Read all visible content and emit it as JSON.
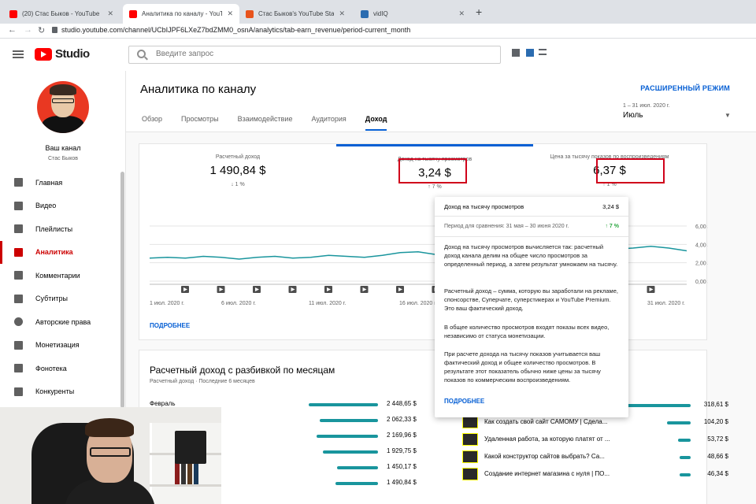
{
  "browser": {
    "tabs": [
      {
        "title": "(20) Стас Быков - YouTube",
        "icon_color": "#ff0000"
      },
      {
        "title": "Аналитика по каналу - YouTube",
        "icon_color": "#ff0000"
      },
      {
        "title": "Стас Быков's YouTube Stats (Sum",
        "icon_color": "#e8531c"
      },
      {
        "title": "vidIQ",
        "icon_color": "#2b6cb0"
      }
    ],
    "new_tab": "+",
    "url": "studio.youtube.com/channel/UCbIJPF6LXeZ7bdZMM0_osnA/analytics/tab-earn_revenue/period-current_month"
  },
  "header": {
    "logo_text": "Studio",
    "search_placeholder": "Введите запрос"
  },
  "sidebar": {
    "channel_name": "Ваш канал",
    "channel_sub": "Стас Быков",
    "items": [
      {
        "label": "Главная",
        "icon": "dashboard-icon"
      },
      {
        "label": "Видео",
        "icon": "video-icon"
      },
      {
        "label": "Плейлисты",
        "icon": "playlist-icon"
      },
      {
        "label": "Аналитика",
        "icon": "analytics-icon",
        "active": true
      },
      {
        "label": "Комментарии",
        "icon": "comments-icon"
      },
      {
        "label": "Субтитры",
        "icon": "subtitles-icon"
      },
      {
        "label": "Авторские права",
        "icon": "copyright-icon"
      },
      {
        "label": "Монетизация",
        "icon": "dollar-icon"
      },
      {
        "label": "Фонотека",
        "icon": "music-icon"
      },
      {
        "label": "Конкуренты",
        "icon": "competitors-icon"
      }
    ]
  },
  "main": {
    "title": "Аналитика по каналу",
    "advanced": "РАСШИРЕННЫЙ РЕЖИМ",
    "tabs": [
      "Обзор",
      "Просмотры",
      "Взаимодействие",
      "Аудитория",
      "Доход"
    ],
    "period_range": "1 – 31 июл. 2020 г.",
    "period_month": "Июль",
    "metrics": [
      {
        "label": "Расчетный доход",
        "value": "1 490,84 $",
        "change": "↓ 1 %"
      },
      {
        "label": "Доход на тысячу просмотров",
        "value": "3,24 $",
        "change": "↑ 7 %"
      },
      {
        "label": "Цена за тысячу показов по воспроизведениям",
        "value": "6,37 $",
        "change": "↑ 1 %"
      }
    ],
    "x_labels": [
      "1 июл. 2020 г.",
      "6 июл. 2020 г.",
      "11 июл. 2020 г.",
      "16 июл. 2020 г.",
      "31 июл. 2020 г."
    ],
    "y_labels": [
      "6,00 $",
      "4,00 $",
      "2,00 $",
      "0,00 $"
    ],
    "more": "ПОДРОБНЕЕ",
    "accent": "#065fd4",
    "line_color": "#19959d"
  },
  "chart_data": {
    "type": "line",
    "title": "",
    "xlabel": "",
    "ylabel": "",
    "ylim": [
      0,
      6
    ],
    "x_ticks": [
      "1 июл. 2020 г.",
      "6 июл. 2020 г.",
      "11 июл. 2020 г.",
      "16 июл. 2020 г.",
      "31 июл. 2020 г."
    ],
    "y_ticks": [
      "0,00 $",
      "2,00 $",
      "4,00 $",
      "6,00 $"
    ],
    "series": [
      {
        "values": [
          2.5,
          2.6,
          2.5,
          2.7,
          2.6,
          2.4,
          2.6,
          2.7,
          2.5,
          2.6,
          2.8,
          2.7,
          2.6,
          2.8,
          3.1,
          3.2,
          2.9,
          3.3,
          3.6,
          3.4,
          3.5,
          3.7,
          3.5,
          3.6,
          3.4,
          3.7,
          3.5,
          3.6,
          3.8,
          3.6,
          3.3
        ]
      }
    ],
    "grid": true
  },
  "monthly": {
    "title": "Расчетный доход с разбивкой по месяцам",
    "subtitle": "Расчетный доход · Последние 6 месяцев",
    "rows": [
      {
        "label": "Февраль",
        "value": "2 448,65 $",
        "fraction": 1.0
      },
      {
        "label": "",
        "value": "2 062,33 $",
        "fraction": 0.84
      },
      {
        "label": "",
        "value": "2 169,96 $",
        "fraction": 0.89
      },
      {
        "label": "",
        "value": "1 929,75 $",
        "fraction": 0.79
      },
      {
        "label": "",
        "value": "1 450,17 $",
        "fraction": 0.59
      },
      {
        "label": "",
        "value": "1 490,84 $",
        "fraction": 0.61
      }
    ]
  },
  "videos": {
    "rows": [
      {
        "title": "",
        "value": "318,61 $",
        "fraction": 1.0
      },
      {
        "title": "Как создать свой сайт САМОМУ | Сдела...",
        "value": "104,20 $",
        "fraction": 0.33
      },
      {
        "title": "Удаленная работа, за которую платят от ...",
        "value": "53,72 $",
        "fraction": 0.17
      },
      {
        "title": "Какой конструктор сайтов выбрать? Са...",
        "value": "48,66 $",
        "fraction": 0.15
      },
      {
        "title": "Создание интернет магазина с нуля | ПО...",
        "value": "46,34 $",
        "fraction": 0.15
      }
    ]
  },
  "tooltip": {
    "metric_label": "Доход на тысячу просмотров",
    "metric_value": "3,24 $",
    "compare_label": "Период для сравнения: 31 мая – 30 июня 2020 г.",
    "compare_value": "↑ 7 %",
    "paragraphs": [
      "Доход на тысячу просмотров вычисляется так: расчетный доход канала делим на общее число просмотров за определенный период, а затем результат умножаем на тысячу.",
      "Расчетный доход – сумма, которую вы заработали на рекламе, спонсорстве, Суперчате, суперстикерах и YouTube Premium. Это ваш фактический доход.",
      "В общее количество просмотров входят показы всех видео, независимо от статуса монетизации.",
      "При расчете дохода на тысячу показов учитывается ваш фактический доход и общее количество просмотров. В результате этот показатель обычно ниже цены за тысячу показов по коммерческим воспроизведениям."
    ],
    "more": "ПОДРОБНЕЕ"
  }
}
